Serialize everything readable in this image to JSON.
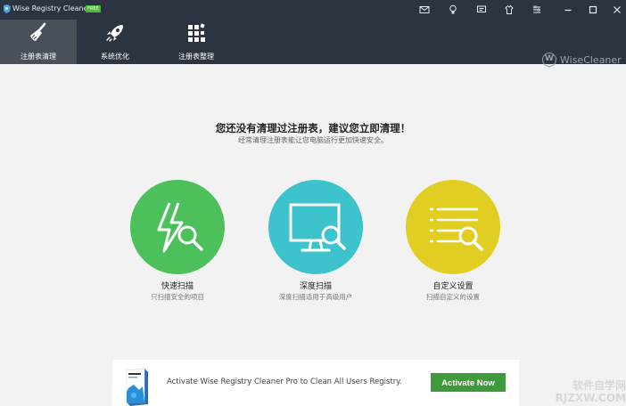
{
  "titlebar": {
    "title": "Wise Registry Cleaner X",
    "badge": "FREE",
    "icons": [
      "mail-icon",
      "lightbulb-icon",
      "chat-icon",
      "tshirt-icon",
      "settings-icon",
      "minimize-icon",
      "maximize-icon",
      "close-icon"
    ]
  },
  "nav": {
    "tabs": [
      {
        "label": "注册表清理",
        "icon": "broom-icon",
        "active": true
      },
      {
        "label": "系统优化",
        "icon": "rocket-icon",
        "active": false
      },
      {
        "label": "注册表整理",
        "icon": "blocks-icon",
        "active": false
      }
    ],
    "brand_letter": "W",
    "brand": "WiseCleaner"
  },
  "main": {
    "headline": "您还没有清理过注册表，建议您立即清理！",
    "subline": "经常清理注册表能让您电脑运行更加快速安全。",
    "options": [
      {
        "title": "快速扫描",
        "subtitle": "只扫描安全的项目",
        "color": "#4cc05a",
        "icon": "lightning-search-icon"
      },
      {
        "title": "深度扫描",
        "subtitle": "深度扫描适用于高级用户",
        "color": "#3cc3cb",
        "icon": "monitor-search-icon"
      },
      {
        "title": "自定义设置",
        "subtitle": "扫描自定义的设置",
        "color": "#e2cd22",
        "icon": "list-search-icon"
      }
    ]
  },
  "promo": {
    "text": "Activate Wise Registry Cleaner Pro to Clean All Users Registry.",
    "button": "Activate Now"
  },
  "watermark": {
    "line1": "软件自学网",
    "line2": "RJZXW.COM"
  }
}
